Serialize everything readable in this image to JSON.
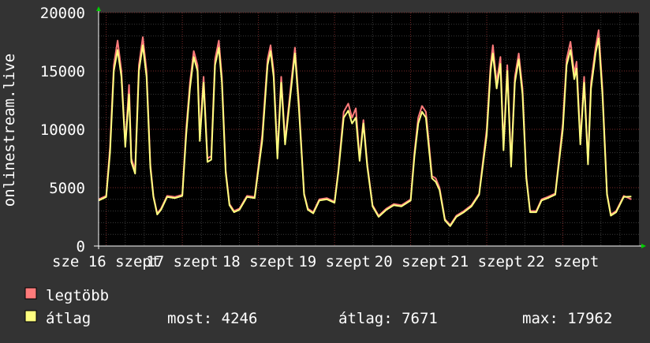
{
  "colors": {
    "background": "#333333",
    "plot_background": "#000000",
    "grid_major": "#7a2a2a",
    "grid_minor": "#3a3a3a",
    "max_line": "#ff7b7b",
    "avg_line": "#ffff80",
    "text": "#ffffff",
    "arrow": "#00cc00"
  },
  "chart_data": {
    "type": "line",
    "ylabel": "onlinestream.live",
    "ylim": [
      0,
      20000
    ],
    "y_ticks": [
      0,
      5000,
      10000,
      15000,
      20000
    ],
    "y_tick_labels": [
      "0",
      "5000",
      "10000",
      "15000",
      "20000"
    ],
    "xlim": [
      15.9,
      23.0
    ],
    "x_ticks": [
      16,
      17,
      18,
      19,
      20,
      21,
      22
    ],
    "x_tick_labels": [
      "sze 16 szept",
      "17 szept",
      "18 szept",
      "19 szept",
      "20 szept",
      "21 szept",
      "22 szept"
    ],
    "grid": true,
    "series": [
      {
        "name": "legtöbb",
        "color": "#ff7b7b",
        "points": [
          [
            15.9,
            4000
          ],
          [
            16.0,
            4300
          ],
          [
            16.05,
            8500
          ],
          [
            16.1,
            15500
          ],
          [
            16.15,
            17600
          ],
          [
            16.2,
            15000
          ],
          [
            16.25,
            8700
          ],
          [
            16.3,
            13800
          ],
          [
            16.33,
            7500
          ],
          [
            16.38,
            6500
          ],
          [
            16.43,
            15500
          ],
          [
            16.48,
            17900
          ],
          [
            16.53,
            15000
          ],
          [
            16.58,
            7000
          ],
          [
            16.62,
            4300
          ],
          [
            16.67,
            2800
          ],
          [
            16.72,
            3200
          ],
          [
            16.8,
            4300
          ],
          [
            16.9,
            4200
          ],
          [
            17.0,
            4400
          ],
          [
            17.05,
            10000
          ],
          [
            17.1,
            14000
          ],
          [
            17.15,
            16700
          ],
          [
            17.2,
            15500
          ],
          [
            17.23,
            9500
          ],
          [
            17.28,
            14500
          ],
          [
            17.33,
            7500
          ],
          [
            17.38,
            7700
          ],
          [
            17.43,
            16000
          ],
          [
            17.48,
            17600
          ],
          [
            17.52,
            14500
          ],
          [
            17.57,
            6500
          ],
          [
            17.62,
            3600
          ],
          [
            17.68,
            3000
          ],
          [
            17.75,
            3200
          ],
          [
            17.85,
            4300
          ],
          [
            17.95,
            4200
          ],
          [
            18.05,
            9500
          ],
          [
            18.12,
            16000
          ],
          [
            18.16,
            17200
          ],
          [
            18.2,
            15000
          ],
          [
            18.25,
            7800
          ],
          [
            18.3,
            14500
          ],
          [
            18.35,
            9000
          ],
          [
            18.43,
            14000
          ],
          [
            18.48,
            17000
          ],
          [
            18.53,
            12500
          ],
          [
            18.6,
            4500
          ],
          [
            18.65,
            3200
          ],
          [
            18.72,
            2900
          ],
          [
            18.8,
            4000
          ],
          [
            18.9,
            4100
          ],
          [
            19.0,
            3800
          ],
          [
            19.05,
            6500
          ],
          [
            19.12,
            11500
          ],
          [
            19.18,
            12200
          ],
          [
            19.23,
            11000
          ],
          [
            19.28,
            11800
          ],
          [
            19.33,
            7500
          ],
          [
            19.38,
            10800
          ],
          [
            19.43,
            7000
          ],
          [
            19.5,
            3500
          ],
          [
            19.58,
            2600
          ],
          [
            19.68,
            3200
          ],
          [
            19.78,
            3600
          ],
          [
            19.88,
            3500
          ],
          [
            20.0,
            4000
          ],
          [
            20.05,
            8000
          ],
          [
            20.1,
            11000
          ],
          [
            20.15,
            12000
          ],
          [
            20.2,
            11500
          ],
          [
            20.23,
            9500
          ],
          [
            20.28,
            6000
          ],
          [
            20.33,
            5800
          ],
          [
            20.38,
            5000
          ],
          [
            20.45,
            2300
          ],
          [
            20.52,
            1800
          ],
          [
            20.6,
            2600
          ],
          [
            20.7,
            3000
          ],
          [
            20.8,
            3500
          ],
          [
            20.9,
            4500
          ],
          [
            21.0,
            10000
          ],
          [
            21.05,
            15500
          ],
          [
            21.08,
            17200
          ],
          [
            21.13,
            14000
          ],
          [
            21.18,
            16200
          ],
          [
            21.22,
            8500
          ],
          [
            21.27,
            15500
          ],
          [
            21.32,
            7000
          ],
          [
            21.37,
            14500
          ],
          [
            21.42,
            16500
          ],
          [
            21.47,
            13500
          ],
          [
            21.52,
            6000
          ],
          [
            21.57,
            3000
          ],
          [
            21.65,
            3000
          ],
          [
            21.72,
            4000
          ],
          [
            21.8,
            4200
          ],
          [
            21.9,
            4500
          ],
          [
            22.0,
            10500
          ],
          [
            22.05,
            16000
          ],
          [
            22.1,
            17500
          ],
          [
            22.15,
            14800
          ],
          [
            22.18,
            15800
          ],
          [
            22.23,
            9000
          ],
          [
            22.28,
            14500
          ],
          [
            22.33,
            7200
          ],
          [
            22.37,
            14000
          ],
          [
            22.43,
            17000
          ],
          [
            22.47,
            18500
          ],
          [
            22.52,
            13500
          ],
          [
            22.58,
            4500
          ],
          [
            22.63,
            2700
          ],
          [
            22.7,
            3000
          ],
          [
            22.8,
            4300
          ],
          [
            22.9,
            4000
          ]
        ]
      },
      {
        "name": "átlag",
        "color": "#ffff80",
        "points": [
          [
            15.9,
            3900
          ],
          [
            16.0,
            4200
          ],
          [
            16.05,
            8000
          ],
          [
            16.1,
            15000
          ],
          [
            16.15,
            16800
          ],
          [
            16.2,
            14500
          ],
          [
            16.25,
            8500
          ],
          [
            16.3,
            13000
          ],
          [
            16.33,
            7200
          ],
          [
            16.38,
            6200
          ],
          [
            16.43,
            15000
          ],
          [
            16.48,
            17200
          ],
          [
            16.53,
            14500
          ],
          [
            16.58,
            6700
          ],
          [
            16.62,
            4200
          ],
          [
            16.67,
            2700
          ],
          [
            16.72,
            3100
          ],
          [
            16.8,
            4200
          ],
          [
            16.9,
            4100
          ],
          [
            17.0,
            4300
          ],
          [
            17.05,
            9500
          ],
          [
            17.1,
            13500
          ],
          [
            17.15,
            16200
          ],
          [
            17.2,
            15000
          ],
          [
            17.23,
            9000
          ],
          [
            17.28,
            14000
          ],
          [
            17.33,
            7200
          ],
          [
            17.38,
            7400
          ],
          [
            17.43,
            15500
          ],
          [
            17.48,
            17000
          ],
          [
            17.52,
            14000
          ],
          [
            17.57,
            6300
          ],
          [
            17.62,
            3500
          ],
          [
            17.68,
            2900
          ],
          [
            17.75,
            3100
          ],
          [
            17.85,
            4200
          ],
          [
            17.95,
            4100
          ],
          [
            18.05,
            9000
          ],
          [
            18.12,
            15500
          ],
          [
            18.16,
            16700
          ],
          [
            18.2,
            14500
          ],
          [
            18.25,
            7500
          ],
          [
            18.3,
            14000
          ],
          [
            18.35,
            8700
          ],
          [
            18.43,
            13500
          ],
          [
            18.48,
            16500
          ],
          [
            18.53,
            12000
          ],
          [
            18.6,
            4400
          ],
          [
            18.65,
            3100
          ],
          [
            18.72,
            2800
          ],
          [
            18.8,
            3900
          ],
          [
            18.9,
            4000
          ],
          [
            19.0,
            3700
          ],
          [
            19.05,
            6300
          ],
          [
            19.12,
            11000
          ],
          [
            19.18,
            11600
          ],
          [
            19.23,
            10500
          ],
          [
            19.28,
            11000
          ],
          [
            19.33,
            7300
          ],
          [
            19.38,
            10500
          ],
          [
            19.43,
            6800
          ],
          [
            19.5,
            3400
          ],
          [
            19.58,
            2500
          ],
          [
            19.68,
            3100
          ],
          [
            19.78,
            3500
          ],
          [
            19.88,
            3400
          ],
          [
            20.0,
            3900
          ],
          [
            20.05,
            7700
          ],
          [
            20.1,
            10500
          ],
          [
            20.15,
            11500
          ],
          [
            20.2,
            11000
          ],
          [
            20.23,
            9000
          ],
          [
            20.28,
            5800
          ],
          [
            20.33,
            5500
          ],
          [
            20.38,
            4800
          ],
          [
            20.45,
            2200
          ],
          [
            20.52,
            1700
          ],
          [
            20.6,
            2500
          ],
          [
            20.7,
            2900
          ],
          [
            20.8,
            3400
          ],
          [
            20.9,
            4400
          ],
          [
            21.0,
            9500
          ],
          [
            21.05,
            15000
          ],
          [
            21.08,
            16500
          ],
          [
            21.13,
            13500
          ],
          [
            21.18,
            15600
          ],
          [
            21.22,
            8200
          ],
          [
            21.27,
            15000
          ],
          [
            21.32,
            6800
          ],
          [
            21.37,
            14000
          ],
          [
            21.42,
            16000
          ],
          [
            21.47,
            13000
          ],
          [
            21.52,
            5800
          ],
          [
            21.57,
            2900
          ],
          [
            21.65,
            2900
          ],
          [
            21.72,
            3900
          ],
          [
            21.8,
            4100
          ],
          [
            21.9,
            4400
          ],
          [
            22.0,
            10000
          ],
          [
            22.05,
            15500
          ],
          [
            22.1,
            16800
          ],
          [
            22.15,
            14300
          ],
          [
            22.18,
            15200
          ],
          [
            22.23,
            8700
          ],
          [
            22.28,
            14000
          ],
          [
            22.33,
            7000
          ],
          [
            22.37,
            13500
          ],
          [
            22.43,
            16500
          ],
          [
            22.47,
            17800
          ],
          [
            22.52,
            13000
          ],
          [
            22.58,
            4400
          ],
          [
            22.63,
            2600
          ],
          [
            22.7,
            2900
          ],
          [
            22.8,
            4200
          ],
          [
            22.9,
            4246
          ]
        ]
      }
    ]
  },
  "legend": [
    {
      "label": "legtöbb",
      "color": "#ff7b7b"
    },
    {
      "label": "átlag",
      "color": "#ffff80"
    }
  ],
  "stats": {
    "current": "most: 4246",
    "average": "átlag: 7671",
    "max": "max: 17962"
  }
}
